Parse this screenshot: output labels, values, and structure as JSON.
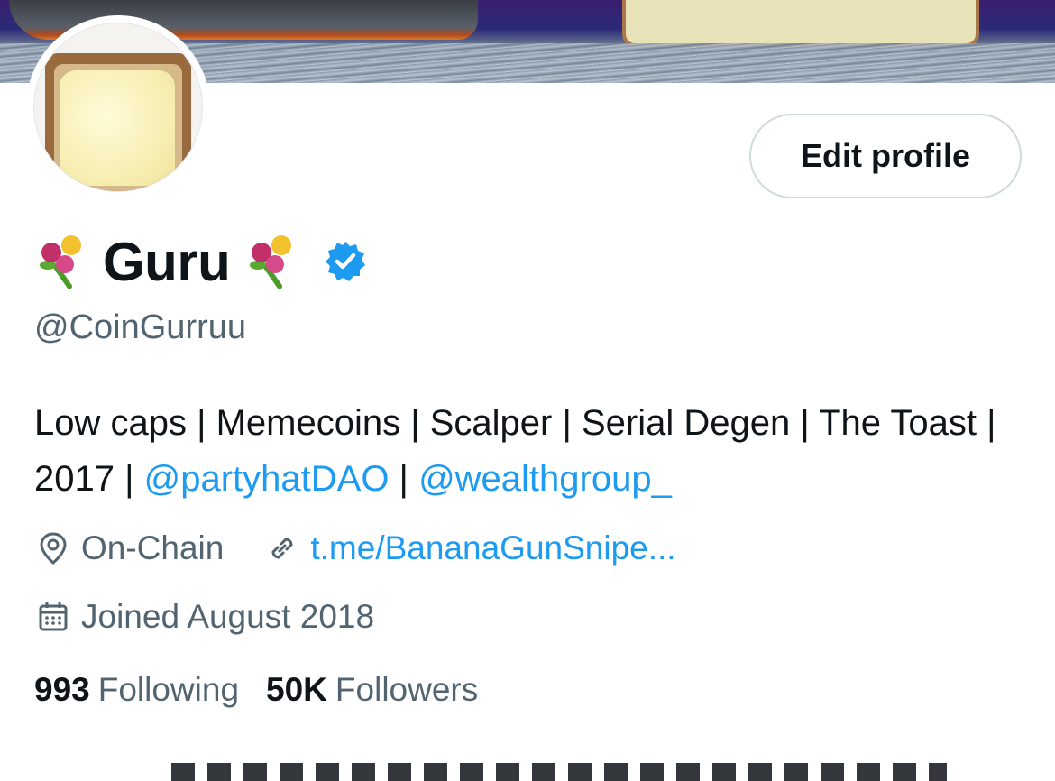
{
  "profile": {
    "name_emoji_left": "💐",
    "display_name": "Guru",
    "name_emoji_right": "💐",
    "handle": "@CoinGurruu",
    "edit_button_label": "Edit profile",
    "bio_text_1": "Low caps | Memecoins | Scalper | Serial Degen | The Toast | 2017 | ",
    "bio_link_1": "@partyhatDAO",
    "bio_sep": " | ",
    "bio_link_2": "@wealthgroup_",
    "location": "On-Chain",
    "website": "t.me/BananaGunSnipe...",
    "joined": "Joined August 2018",
    "following_count": "993",
    "following_label": "Following",
    "followers_count": "50K",
    "followers_label": "Followers"
  },
  "icons": {
    "verified": "verified-badge-icon",
    "location": "location-pin-icon",
    "link": "link-icon",
    "calendar": "calendar-icon",
    "name_decoration": "bouquet-icon"
  },
  "colors": {
    "accent": "#1d9bf0",
    "text_primary": "#0f1419",
    "text_secondary": "#536471",
    "border": "#cfd9de"
  }
}
